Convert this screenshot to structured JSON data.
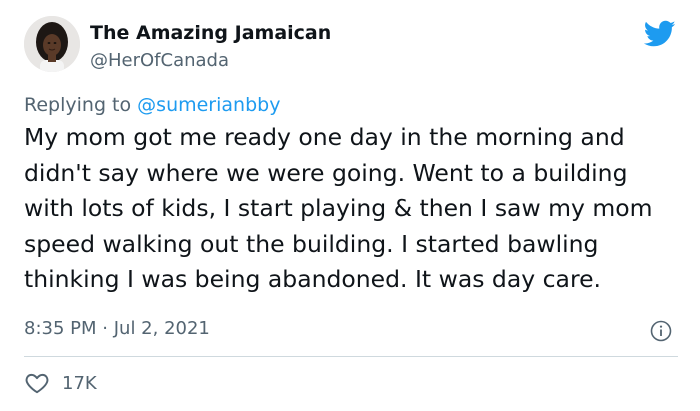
{
  "user": {
    "display_name": "The Amazing Jamaican",
    "handle": "@HerOfCanada",
    "avatar_icon": "profile-photo"
  },
  "reply": {
    "prefix": "Replying to",
    "mention": "@sumerianbby"
  },
  "tweet_text": "My mom got me ready one day in the morning and didn't say where we were going. Went to a building with lots of kids, I start playing & then I saw my mom speed walking out the building. I started bawling thinking I was being abandoned. It was day care.",
  "meta": {
    "time": "8:35 PM",
    "separator": "·",
    "date": "Jul 2, 2021"
  },
  "actions": {
    "like_count": "17K"
  },
  "colors": {
    "brand_blue": "#1d9bf0",
    "secondary_text": "#536471",
    "divider": "#cfd9de",
    "primary_text": "#0f1419"
  },
  "icons": {
    "logo": "twitter-bird-icon",
    "info": "info-icon",
    "like": "heart-icon"
  }
}
